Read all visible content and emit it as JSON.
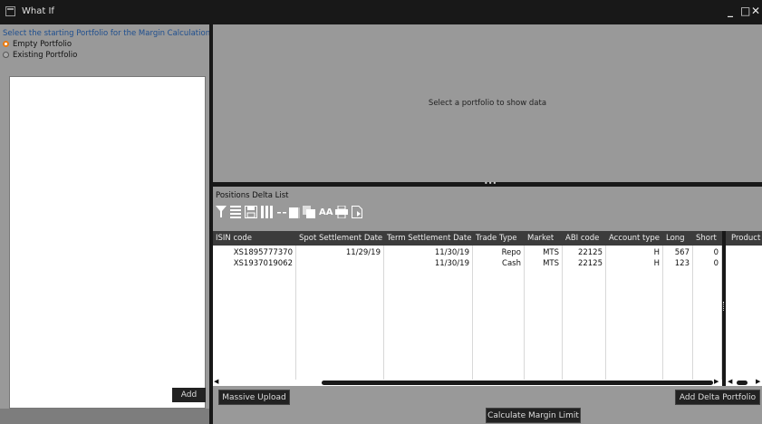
{
  "window": {
    "title": "What If",
    "controls": {
      "minimize": "_",
      "maximize": "□",
      "close": "✕"
    }
  },
  "left": {
    "prompt": "Select the starting Portfolio for the Margin Calculation",
    "options": [
      {
        "label": "Empty Portfolio",
        "selected": true
      },
      {
        "label": "Existing Portfolio",
        "selected": false
      }
    ],
    "add_label": "Add"
  },
  "top": {
    "message": "Select a portfolio to show data",
    "splitter_grip": "•••"
  },
  "positions": {
    "caption": "Positions Delta List",
    "columns": [
      "ISIN code",
      "Spot Settlement Date",
      "Term Settlement Date",
      "Trade Type",
      "Market",
      "ABI code",
      "Account type",
      "Long",
      "Short"
    ],
    "rows": [
      [
        "XS1895777370",
        "11/29/19",
        "11/30/19",
        "Repo",
        "MTS",
        "22125",
        "H",
        "567",
        "0"
      ],
      [
        "XS1937019062",
        "",
        "11/30/19",
        "Cash",
        "MTS",
        "22125",
        "H",
        "123",
        "0"
      ]
    ],
    "right_column": "Product"
  },
  "toolbar_icons": [
    "filter-icon",
    "list-icon",
    "save-icon",
    "columns-icon",
    "collapse-icon",
    "window-icon",
    "duplicate-icon",
    "font-size-icon",
    "print-icon",
    "export-icon"
  ],
  "toolbar_text": {
    "font_size": "AA"
  },
  "buttons": {
    "massive_upload": "Massive Upload",
    "add_delta_portfolio": "Add Delta Portfolio",
    "calculate_margin_limit": "Calculate Margin Limit"
  },
  "colors": {
    "accent": "#e87a10",
    "prompt": "#1d4e8f",
    "titlebar": "#181818",
    "panel": "#999999"
  }
}
